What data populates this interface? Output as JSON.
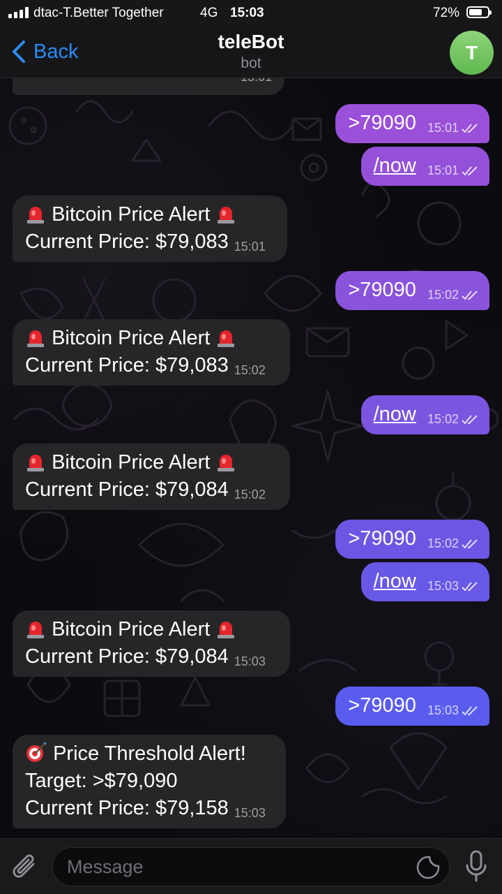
{
  "status_bar": {
    "carrier": "dtac-T.Better Together",
    "network": "4G",
    "time": "15:03",
    "battery_percent": "72%",
    "battery_level": 0.72
  },
  "nav": {
    "back_label": "Back",
    "title": "teleBot",
    "subtitle": "bot",
    "avatar_letter": "T"
  },
  "messages": [
    {
      "dir": "in",
      "partial": true,
      "time": "15:01"
    },
    {
      "dir": "out",
      "text": ">79090",
      "time": "15:01",
      "link": false
    },
    {
      "dir": "out",
      "text": "/now",
      "time": "15:01",
      "link": true
    },
    {
      "dir": "in",
      "line1": "Bitcoin Price Alert",
      "line2": "Current Price: $79,083",
      "time": "15:01"
    },
    {
      "dir": "out",
      "text": ">79090",
      "time": "15:02",
      "link": false
    },
    {
      "dir": "in",
      "line1": "Bitcoin Price Alert",
      "line2": "Current Price: $79,083",
      "time": "15:02"
    },
    {
      "dir": "out",
      "text": "/now",
      "time": "15:02",
      "link": true
    },
    {
      "dir": "in",
      "line1": "Bitcoin Price Alert",
      "line2": "Current Price: $79,084",
      "time": "15:02"
    },
    {
      "dir": "out",
      "text": ">79090",
      "time": "15:02",
      "link": false
    },
    {
      "dir": "out",
      "text": "/now",
      "time": "15:03",
      "link": true
    },
    {
      "dir": "in",
      "line1": "Bitcoin Price Alert",
      "line2": "Current Price: $79,084",
      "time": "15:03"
    },
    {
      "dir": "out",
      "text": ">79090",
      "time": "15:03",
      "link": false
    },
    {
      "dir": "in",
      "line1": "Price Threshold Alert!",
      "line2": "Target: >$79,090",
      "line3": "Current Price: $79,158",
      "time": "15:03"
    }
  ],
  "composer": {
    "placeholder": "Message"
  },
  "colors": {
    "accent": "#2c8cf5",
    "incoming_bubble": "#262628",
    "outgoing_top": "#9a4fd8",
    "outgoing_bottom": "#5a5cf0",
    "avatar": "#6cc05c"
  }
}
